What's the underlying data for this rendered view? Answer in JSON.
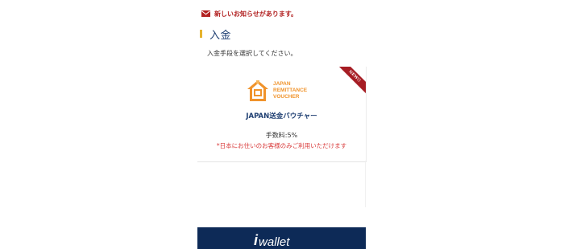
{
  "notice": {
    "icon": "mail-icon",
    "text": "新しいお知らせがあります。"
  },
  "section": {
    "title": "入金"
  },
  "instruction": "入金手段を選択してください。",
  "card": {
    "ribbon": "NEW!!",
    "logo_lines": [
      "JAPAN",
      "REMITTANCE",
      "VOUCHER"
    ],
    "title": "JAPAN送金バウチャー",
    "fee": "手数料:5%",
    "note": "*日本にお住いのお客様のみご利用いただけます"
  },
  "wallet_banner": {
    "logo_mark": "i",
    "logo_text": "wallet"
  },
  "colors": {
    "accent_red": "#b22222",
    "title_navy": "#1f3f72",
    "bar_gold": "#e6b32e",
    "banner_navy": "#0d2a57",
    "logo_orange": "#f0932b"
  }
}
